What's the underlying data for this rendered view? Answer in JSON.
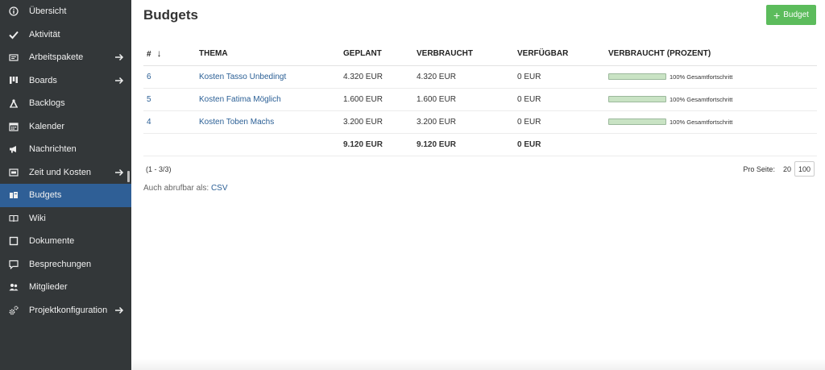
{
  "sidebar": {
    "items": [
      {
        "label": "Übersicht",
        "icon": "info-icon",
        "arrow": false,
        "active": false
      },
      {
        "label": "Aktivität",
        "icon": "checkmark-icon",
        "arrow": false,
        "active": false
      },
      {
        "label": "Arbeitspakete",
        "icon": "work-packages-icon",
        "arrow": true,
        "active": false
      },
      {
        "label": "Boards",
        "icon": "boards-icon",
        "arrow": true,
        "active": false
      },
      {
        "label": "Backlogs",
        "icon": "backlogs-icon",
        "arrow": false,
        "active": false
      },
      {
        "label": "Kalender",
        "icon": "calendar-icon",
        "arrow": false,
        "active": false
      },
      {
        "label": "Nachrichten",
        "icon": "megaphone-icon",
        "arrow": false,
        "active": false
      },
      {
        "label": "Zeit und Kosten",
        "icon": "time-cost-icon",
        "arrow": true,
        "active": false
      },
      {
        "label": "Budgets",
        "icon": "budget-icon",
        "arrow": false,
        "active": true
      },
      {
        "label": "Wiki",
        "icon": "book-icon",
        "arrow": false,
        "active": false
      },
      {
        "label": "Dokumente",
        "icon": "document-icon",
        "arrow": false,
        "active": false
      },
      {
        "label": "Besprechungen",
        "icon": "speech-bubble-icon",
        "arrow": false,
        "active": false
      },
      {
        "label": "Mitglieder",
        "icon": "members-icon",
        "arrow": false,
        "active": false
      },
      {
        "label": "Projektkonfiguration",
        "icon": "gears-icon",
        "arrow": true,
        "active": false
      }
    ]
  },
  "header": {
    "title": "Budgets",
    "add_button_label": "Budget"
  },
  "table": {
    "columns": [
      "#",
      "THEMA",
      "GEPLANT",
      "VERBRAUCHT",
      "VERFÜGBAR",
      "VERBRAUCHT (PROZENT)"
    ],
    "rows": [
      {
        "id": "6",
        "subject": "Kosten Tasso Unbedingt",
        "planned": "4.320 EUR",
        "spent": "4.320 EUR",
        "available": "0 EUR",
        "progress_text": "100% Gesamtfortschritt",
        "progress": 1.0
      },
      {
        "id": "5",
        "subject": "Kosten Fatima Möglich",
        "planned": "1.600 EUR",
        "spent": "1.600 EUR",
        "available": "0 EUR",
        "progress_text": "100% Gesamtfortschritt",
        "progress": 1.0
      },
      {
        "id": "4",
        "subject": "Kosten Toben Machs",
        "planned": "3.200 EUR",
        "spent": "3.200 EUR",
        "available": "0 EUR",
        "progress_text": "100% Gesamtfortschritt",
        "progress": 1.0
      }
    ],
    "totals": {
      "planned": "9.120 EUR",
      "spent": "9.120 EUR",
      "available": "0 EUR"
    }
  },
  "pagination": {
    "info": "(1 - 3/3)",
    "per_page_label": "Pro Seite:",
    "options": [
      "20",
      "100"
    ],
    "selected": "100"
  },
  "export": {
    "label": "Auch abrufbar als:",
    "csv": "CSV"
  },
  "colors": {
    "sidebar_bg": "#333739",
    "active_bg": "#2f5f96",
    "add_button": "#5cbc5c",
    "link": "#2c6096",
    "progress_fill": "#c9e3c4"
  }
}
